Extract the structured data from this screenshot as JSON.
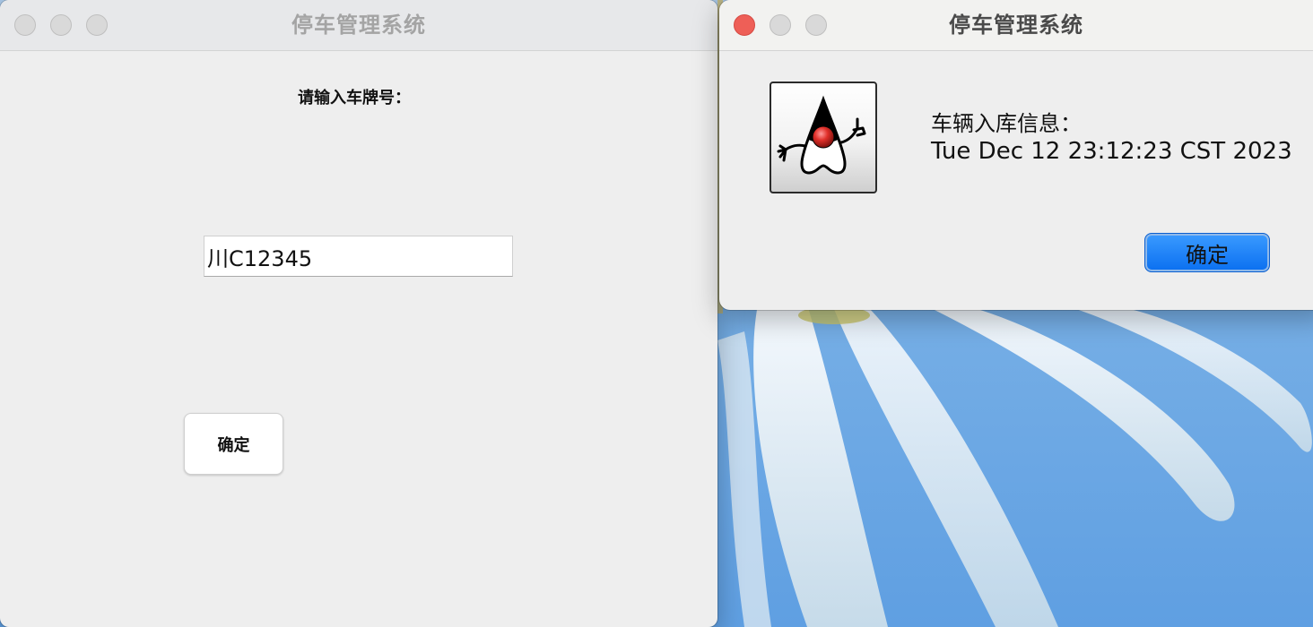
{
  "main_window": {
    "title": "停车管理系统",
    "prompt_label": "请输入车牌号：",
    "plate_input_value": "川C12345",
    "confirm_label": "确定"
  },
  "dialog": {
    "title": "停车管理系统",
    "message_line1": "车辆入库信息：",
    "message_line2": "Tue Dec 12 23:12:23 CST 2023",
    "confirm_label": "确定",
    "icon": "java-duke-icon"
  },
  "colors": {
    "close_red": "#ee5f57",
    "traffic_gray": "#d9d9d9",
    "default_button_blue": "#0a6ff0",
    "window_bg": "#eeeeee"
  }
}
